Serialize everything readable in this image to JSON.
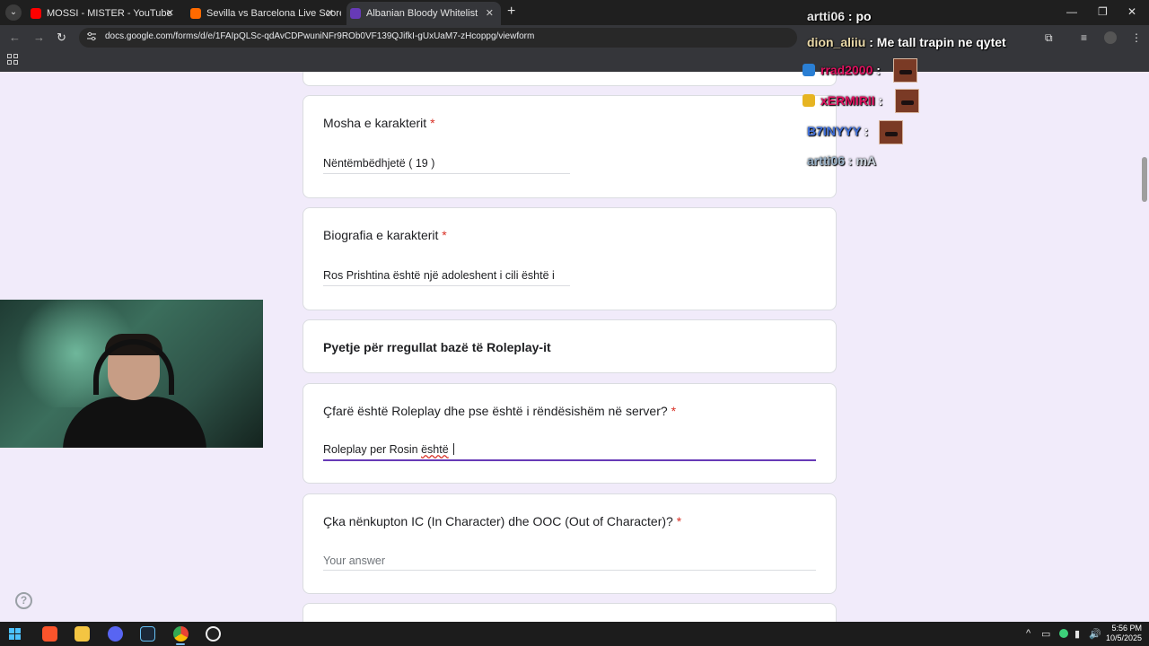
{
  "browser": {
    "tabs": [
      {
        "label": "MOSSI - MISTER - YouTube",
        "favicon": "youtube-icon",
        "color": "#ff0000"
      },
      {
        "label": "Sevilla vs Barcelona Live Scores",
        "favicon": "livescore-icon",
        "color": "#ff6a00"
      },
      {
        "label": "Albanian Bloody Whitelist",
        "favicon": "google-forms-icon",
        "color": "#673ab7"
      }
    ],
    "url": "docs.google.com/forms/d/e/1FAIpQLSc-qdAvCDPwuniNFr9ROb0VF139QJifkI-gUxUaM7-zHcoppg/viewform"
  },
  "form": {
    "questions": [
      {
        "title": "Mosha e karakterit",
        "required": "*",
        "answer": "Nëntëmbëdhjetë ( 19 )"
      },
      {
        "title": "Biografia e karakterit",
        "required": "*",
        "answer": "Ros Prishtina është një adoleshent i cili është i"
      },
      {
        "section": "Pyetje për rregullat bazë të Roleplay-it"
      },
      {
        "title": "Çfarë është Roleplay dhe pse është i rëndësishëm në server?",
        "required": "*",
        "answer_prefix": "Roleplay per Rosin ",
        "answer_misspelled": "është",
        "answer_suffix": " "
      },
      {
        "title": "Çka nënkupton IC (In Character) dhe OOC (Out of Character)?",
        "required": "*",
        "placeholder": "Your answer"
      }
    ]
  },
  "chat": [
    {
      "user": "artti06",
      "sep": ":",
      "message": "po"
    },
    {
      "user": "dion_aliiu",
      "sep": ":",
      "message": "Me tall trapin ne qytet"
    },
    {
      "user": "rrad2000",
      "sep": ":",
      "color": "#e0115f"
    },
    {
      "user": "xERMIRII",
      "sep": ":",
      "color": "#e0115f"
    },
    {
      "user": "B7INYYY",
      "sep": ":",
      "color": "#3f6fd8"
    },
    {
      "user": "artti06",
      "sep": ":",
      "message": "mA"
    }
  ],
  "taskbar": {
    "time": "5:56 PM",
    "date": "10/5/2025",
    "apps": [
      "windows-start-icon",
      "brave-icon",
      "file-explorer-icon",
      "discord-icon",
      "steam-icon",
      "chrome-icon",
      "fivem-icon"
    ]
  },
  "colors": {
    "accent": "#673ab7",
    "required": "#d93025",
    "background": "#f1ebfa"
  }
}
